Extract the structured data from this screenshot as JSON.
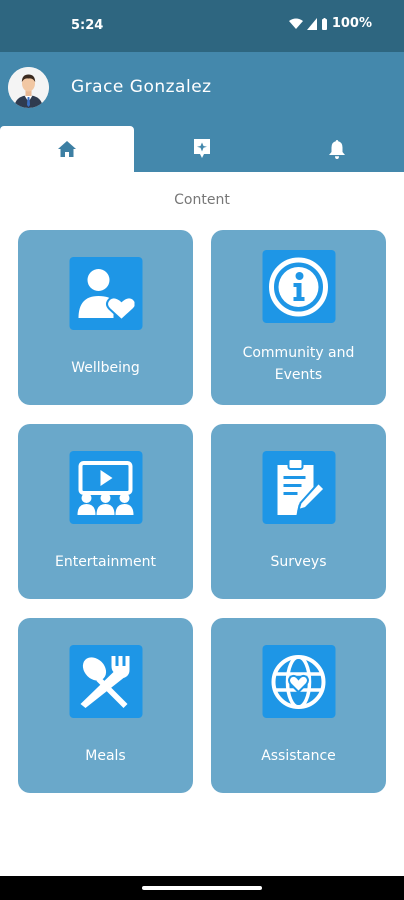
{
  "status_bar": {
    "time": "5:24",
    "battery": "100%"
  },
  "header": {
    "user_name": "Grace Gonzalez",
    "tabs": [
      {
        "icon": "home-icon",
        "active": true
      },
      {
        "icon": "sparkle-bookmark-icon",
        "active": false
      },
      {
        "icon": "bell-icon",
        "active": false
      }
    ]
  },
  "content": {
    "title": "Content",
    "cards": [
      {
        "label": "Wellbeing",
        "icon": "person-heart-icon"
      },
      {
        "label": "Community and Events",
        "icon": "info-icon"
      },
      {
        "label": "Entertainment",
        "icon": "video-audience-icon"
      },
      {
        "label": "Surveys",
        "icon": "clipboard-pencil-icon"
      },
      {
        "label": "Meals",
        "icon": "spoon-fork-icon"
      },
      {
        "label": "Assistance",
        "icon": "globe-heart-icon"
      }
    ]
  },
  "colors": {
    "status_bar": "#2e6680",
    "header": "#4488ac",
    "card": "#6aa8ca",
    "icon_tile": "#1e96e6"
  }
}
